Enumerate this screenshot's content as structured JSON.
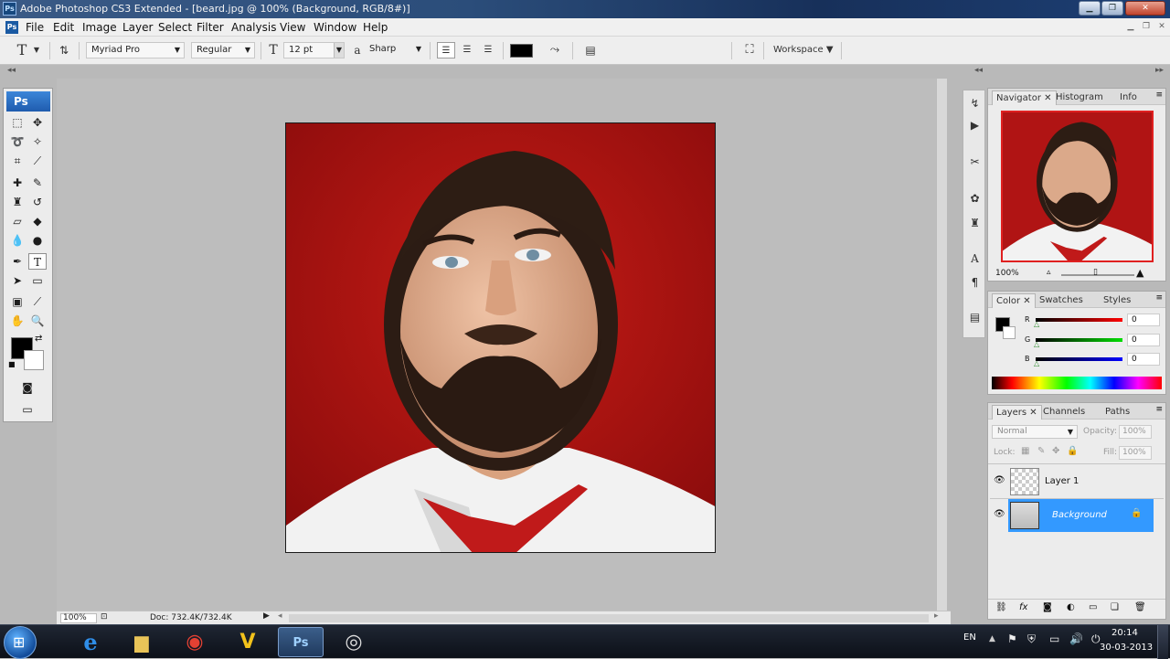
{
  "window": {
    "title": "Adobe Photoshop CS3 Extended - [beard.jpg @ 100% (Background, RGB/8#)]",
    "app_badge": "Ps"
  },
  "menu": [
    "File",
    "Edit",
    "Image",
    "Layer",
    "Select",
    "Filter",
    "Analysis",
    "View",
    "Window",
    "Help"
  ],
  "options": {
    "tool_glyph": "T",
    "font_family": "Myriad Pro",
    "font_style": "Regular",
    "font_size": "12 pt",
    "aa_label": "a",
    "antialias": "Sharp",
    "workspace": "Workspace"
  },
  "toolbox": {
    "badge": "Ps"
  },
  "status": {
    "zoom": "100%",
    "doc": "Doc: 732.4K/732.4K"
  },
  "navigator": {
    "tabs": [
      "Navigator",
      "Histogram",
      "Info"
    ],
    "zoom": "100%"
  },
  "color": {
    "tabs": [
      "Color",
      "Swatches",
      "Styles"
    ],
    "channels": [
      {
        "label": "R",
        "value": "0"
      },
      {
        "label": "G",
        "value": "0"
      },
      {
        "label": "B",
        "value": "0"
      }
    ]
  },
  "layers": {
    "tabs": [
      "Layers",
      "Channels",
      "Paths"
    ],
    "blend_mode": "Normal",
    "opacity_label": "Opacity:",
    "opacity": "100%",
    "lock_label": "Lock:",
    "fill_label": "Fill:",
    "fill": "100%",
    "items": [
      {
        "name": "Layer 1",
        "selected": false
      },
      {
        "name": "Background",
        "selected": true
      }
    ]
  },
  "taskbar": {
    "apps": [
      "internet-explorer",
      "file-explorer",
      "chrome",
      "v-app",
      "photoshop",
      "media-app"
    ],
    "ps_label": "Ps",
    "lang": "EN",
    "time": "20:14",
    "date": "30-03-2013"
  },
  "colors": {
    "photo_background": "#a80f0f",
    "selection": "#3399ff",
    "fg_swatch": "#000000"
  }
}
